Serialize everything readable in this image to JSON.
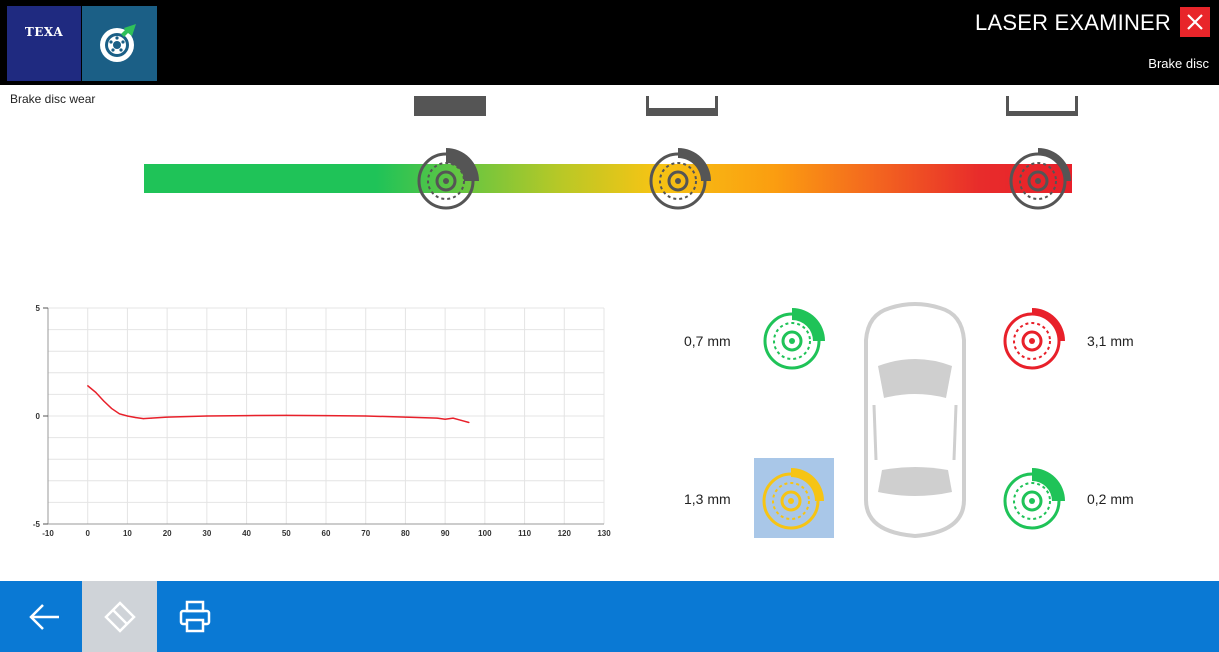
{
  "header": {
    "logo_text": "TEXA",
    "title": "LASER EXAMINER",
    "subtitle": "Brake disc"
  },
  "wear_scale": {
    "label": "Brake disc wear",
    "markers": [
      "light-wear",
      "medium-wear",
      "heavy-wear"
    ]
  },
  "chart_data": {
    "type": "line",
    "title": "",
    "xlabel": "",
    "ylabel": "",
    "xlim": [
      -10,
      130
    ],
    "ylim": [
      -5,
      5
    ],
    "x_ticks": [
      "-10",
      "0",
      "10",
      "20",
      "30",
      "40",
      "50",
      "60",
      "70",
      "80",
      "90",
      "100",
      "110",
      "120",
      "130"
    ],
    "y_ticks": [
      "5",
      "0",
      "-5"
    ],
    "grid": true,
    "series": [
      {
        "color": "#e8202a",
        "x": [
          0,
          2,
          4,
          6,
          8,
          10,
          12,
          14,
          16,
          20,
          30,
          40,
          50,
          60,
          70,
          80,
          88,
          90,
          92,
          94,
          96
        ],
        "y": [
          1.4,
          1.1,
          0.7,
          0.35,
          0.1,
          0.0,
          -0.07,
          -0.12,
          -0.1,
          -0.05,
          0.0,
          0.02,
          0.03,
          0.02,
          0.0,
          -0.05,
          -0.1,
          -0.15,
          -0.1,
          -0.2,
          -0.3
        ]
      }
    ]
  },
  "wheels": {
    "front_left": {
      "value": "0,7 mm",
      "status": "green",
      "color": "#1fc358"
    },
    "front_right": {
      "value": "3,1 mm",
      "status": "red",
      "color": "#e8202a"
    },
    "rear_left": {
      "value": "1,3 mm",
      "status": "yellow",
      "color": "#f6c414",
      "selected": true
    },
    "rear_right": {
      "value": "0,2 mm",
      "status": "green",
      "color": "#1fc358"
    }
  },
  "footer": {
    "buttons": [
      "back-arrow-icon",
      "eraser-icon",
      "print-icon"
    ]
  },
  "colors": {
    "accent": "#0a79d4",
    "header_bg": "#000000",
    "close": "#e8252a",
    "logo_bg": "#1f2a80"
  }
}
